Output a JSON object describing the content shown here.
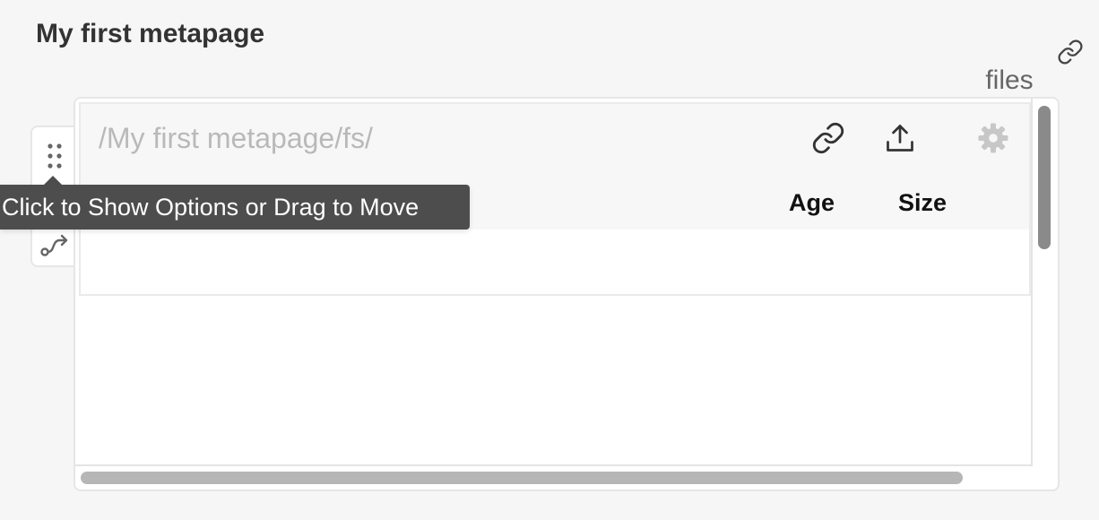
{
  "page": {
    "title": "My first metapage",
    "icons": {
      "link": "link-icon"
    }
  },
  "component": {
    "label": "files",
    "handle_icon": "drag-handle-icon",
    "connect_icon": "connect-icon",
    "tooltip": "Click to Show Options or Drag to Move",
    "toolbar": {
      "path": "/My first metapage/fs/",
      "copy_link_icon": "link-icon",
      "upload_icon": "upload-icon",
      "settings_icon": "gear-icon"
    },
    "table": {
      "columns": [
        "Age",
        "Size"
      ],
      "rows": []
    }
  },
  "colors": {
    "background": "#f6f6f6",
    "tooltip_bg": "#4d4d4d",
    "path_text": "#b9b9b9",
    "scrollbar_thumb": "#8a8a8a"
  }
}
